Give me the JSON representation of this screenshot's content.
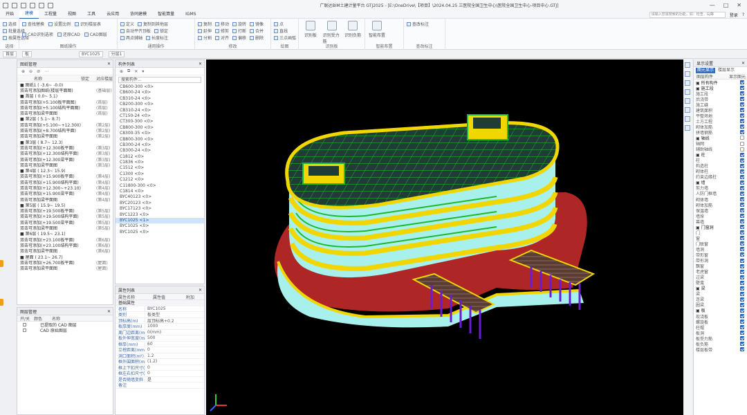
{
  "window": {
    "title": "广联达BIM土建计量平台 GTJ2025 - [E:\\OneDrive\\【项目】\\2024.04.25 三医院全国卫生中心\\医院全国卫生中心-项目中心.GTJ]",
    "controls": [
      "—",
      "□",
      "✕"
    ]
  },
  "menu": {
    "tabs": [
      "开始",
      "建模",
      "工程量",
      "视图",
      "工具",
      "云应用",
      "协同建模",
      "智能算量",
      "IGMS"
    ],
    "active": 1,
    "search_placeholder": "请输入您需搜索的功能，如：检查、GJ等",
    "user": "登录",
    "help": "?"
  },
  "ribbon": {
    "groups": [
      {
        "label": "选择",
        "items": [
          "选择",
          "批量选择",
          "按属性选择"
        ]
      },
      {
        "label": "图纸操作",
        "items": [
          "查找替换",
          "设置比例",
          "识别楼层表",
          "CAD识别选项",
          "还原CAD",
          "CAD图层"
        ]
      },
      {
        "label": "通用操作",
        "items": [
          "定义",
          "复制到其他层",
          "自动平齐顶板",
          "锁定",
          "两点辅轴",
          "长度标注"
        ]
      },
      {
        "label": "修改",
        "items": [
          "复制",
          "移动",
          "旋转",
          "镜像",
          "延伸",
          "修剪",
          "打断",
          "合并",
          "分割",
          "对齐",
          "偏移",
          "删除"
        ]
      },
      {
        "label": "绘图",
        "items": [
          "点",
          "直线",
          "三点画弧"
        ]
      },
      {
        "label": "识别板",
        "items": [
          "识别板",
          "识别受力筋",
          "识别负筋"
        ]
      },
      {
        "label": "智能布置",
        "items": [
          "智能布置"
        ]
      },
      {
        "label": "查改标注",
        "items": [
          "查改标注"
        ]
      }
    ]
  },
  "panebar": {
    "floor": "首层",
    "type": "板",
    "component": "BYC1025",
    "layer": "分层1"
  },
  "nav_panel": {
    "title": "图纸管理",
    "cols": [
      "名称",
      "锁定",
      "对应楼层"
    ],
    "rows": [
      {
        "n": "■ 图纸1 ( -3.6~ -0.0)",
        "c": "",
        "v": ""
      },
      {
        "n": "  双击可添加图纸(楼层平面图)",
        "c": "",
        "v": "(基础层)"
      },
      {
        "n": "■ 首层 ( 0.0~ 5.1)",
        "c": "",
        "v": ""
      },
      {
        "n": "  双击可添加(+5.100板平面图)",
        "c": "",
        "v": "(首层)"
      },
      {
        "n": "  双击可添加(+5.100结构平面图)",
        "c": "",
        "v": "(首层)"
      },
      {
        "n": "  双击可添加梁平面图",
        "c": "",
        "v": "(首层)"
      },
      {
        "n": "■ 第2层 ( 5.1~ 8.7)",
        "c": "",
        "v": ""
      },
      {
        "n": "  双击可添加(+5.100~+12.300)",
        "c": "",
        "v": "(第2层)"
      },
      {
        "n": "  双击可添加(+8.700结构平面)",
        "c": "",
        "v": "(第2层)"
      },
      {
        "n": "  双击可添加梁平面图",
        "c": "",
        "v": "(第2层)"
      },
      {
        "n": "■ 第3层 ( 8.7~ 12.3)",
        "c": "",
        "v": ""
      },
      {
        "n": "  双击可添加(+12.300板平面)",
        "c": "",
        "v": "(第3层)"
      },
      {
        "n": "  双击可添加(+12.300结构平面)",
        "c": "",
        "v": "(第3层)"
      },
      {
        "n": "  双击可添加(+12.300梁平面)",
        "c": "",
        "v": "(第3层)"
      },
      {
        "n": "  双击可添加梁平面图",
        "c": "",
        "v": "(第3层)"
      },
      {
        "n": "■ 第4层 ( 12.3~ 15.9)",
        "c": "",
        "v": ""
      },
      {
        "n": "  双击可添加(+15.900板平面)",
        "c": "",
        "v": "(第4层)"
      },
      {
        "n": "  双击可添加(+15.900结构平面)",
        "c": "",
        "v": "(第4层)"
      },
      {
        "n": "  双击可添加(+12.300~+23.10)",
        "c": "",
        "v": "(第4层)"
      },
      {
        "n": "  双击可添加(+15.900梁平面)",
        "c": "",
        "v": "(第4层)"
      },
      {
        "n": "  双击可添加梁平面图",
        "c": "",
        "v": "(第4层)"
      },
      {
        "n": "■ 第5层 ( 15.9~ 19.5)",
        "c": "",
        "v": ""
      },
      {
        "n": "  双击可添加(+19.500板平面)",
        "c": "",
        "v": "(第5层)"
      },
      {
        "n": "  双击可添加(+19.500结构平面)",
        "c": "",
        "v": "(第5层)"
      },
      {
        "n": "  双击可添加(+19.500梁平面)",
        "c": "",
        "v": "(第5层)"
      },
      {
        "n": "  双击可添加梁平面图",
        "c": "",
        "v": "(第5层)"
      },
      {
        "n": "■ 第6层 ( 19.5~ 23.1)",
        "c": "",
        "v": ""
      },
      {
        "n": "  双击可添加(+23.100板平面)",
        "c": "",
        "v": "(第6层)"
      },
      {
        "n": "  双击可添加(+23.100结构平面)",
        "c": "",
        "v": "(第6层)"
      },
      {
        "n": "  双击可添加梁平面图",
        "c": "",
        "v": "(第6层)"
      },
      {
        "n": "■ 屋面 ( 23.1~ 26.7)",
        "c": "",
        "v": ""
      },
      {
        "n": "  双击可添加(+26.700板平面)",
        "c": "",
        "v": "(屋面)"
      },
      {
        "n": "  双击可添加梁平面图",
        "c": "",
        "v": "(屋面)"
      }
    ]
  },
  "layer_panel": {
    "title": "图层管理",
    "cols": [
      "开/关",
      "颜色",
      "名称"
    ],
    "rows": [
      "已提取的 CAD 图层",
      "CAD 原始图层"
    ]
  },
  "comp_panel": {
    "title": "构件列表",
    "search": "搜索构件...",
    "items": [
      "CB600-300 <0>",
      "CB600-24 <0>",
      "CB310-24 <0>",
      "CB200-300 <0>",
      "CB310-24 <0>",
      "CT150-24 <0>",
      "CT300-300 <0>",
      "CB800-300 <0>",
      "C8300-35 <0>",
      "CB800-300 <0>",
      "CB300-24 <0>",
      "CB300-24 <0>",
      "C1812 <0>",
      "C1836 <0>",
      "C1512 <0>",
      "C1300 <0>",
      "C1212 <0>",
      "C11800-300 <0>",
      "C1814 <0>",
      "BYC40123 <0>",
      "BYC20123 <0>",
      "BYC17123 <0>",
      "BYC1223 <0>",
      "BYC1025 <1>",
      "BYC1025 <0>",
      "BYC1025 <0>"
    ],
    "selected": 23
  },
  "prop_panel": {
    "title": "属性列表",
    "cols": [
      "属性名称",
      "属性值",
      "附加"
    ],
    "group": "基础属性",
    "rows": [
      {
        "k": "名称",
        "v": "BYC1025"
      },
      {
        "k": "类别",
        "v": "板类型"
      },
      {
        "k": "顶标高(m)",
        "v": "层顶标高+0.2"
      },
      {
        "k": "板厚度(mm)",
        "v": "1000"
      },
      {
        "k": "离门边距离(mm)",
        "v": "0(mm)"
      },
      {
        "k": "板外伸宽度(mm)",
        "v": "500"
      },
      {
        "k": "框厚(mm)",
        "v": "60"
      },
      {
        "k": "立樘距离(mm)",
        "v": "0"
      },
      {
        "k": "洞口面积(m²)",
        "v": "1.2"
      },
      {
        "k": "框外围面积(m²)",
        "v": "(1.2)"
      },
      {
        "k": "框上下扣尺寸(...)",
        "v": "0"
      },
      {
        "k": "框左右扣尺寸(...)",
        "v": "0"
      },
      {
        "k": "是否随墙变斜",
        "v": "是"
      },
      {
        "k": "备注",
        "v": ""
      }
    ]
  },
  "display_panel": {
    "title": "显示设置",
    "tabs": [
      "图元显示",
      "楼层显示"
    ],
    "cols": [
      "图层构件",
      "显示图元"
    ],
    "rows": [
      {
        "n": "▣ 所有构件",
        "g": true,
        "c": true
      },
      {
        "n": "▣ 施工段",
        "g": true,
        "c": true
      },
      {
        "n": "  施工段",
        "g": false,
        "c": true
      },
      {
        "n": "  后浇带",
        "g": false,
        "c": true
      },
      {
        "n": "  施工缝",
        "g": false,
        "c": true
      },
      {
        "n": "  建筑面积",
        "g": false,
        "c": true
      },
      {
        "n": "  平整场地",
        "g": false,
        "c": true
      },
      {
        "n": "  土方工程",
        "g": false,
        "c": true
      },
      {
        "n": "  砌体加筋",
        "g": false,
        "c": true
      },
      {
        "n": "  拼墙钢筋",
        "g": false,
        "c": true
      },
      {
        "n": "▣ 轴线",
        "g": true,
        "c": false
      },
      {
        "n": "  轴网",
        "g": false,
        "c": false
      },
      {
        "n": "  辅助轴线",
        "g": false,
        "c": false
      },
      {
        "n": "▣ 柱",
        "g": true,
        "c": true
      },
      {
        "n": "  柱",
        "g": false,
        "c": true
      },
      {
        "n": "  构造柱",
        "g": false,
        "c": true
      },
      {
        "n": "  砌体柱",
        "g": false,
        "c": true
      },
      {
        "n": "  约束边缘柱",
        "g": false,
        "c": true
      },
      {
        "n": "▣ 墙",
        "g": true,
        "c": true
      },
      {
        "n": "  剪力墙",
        "g": false,
        "c": true
      },
      {
        "n": "  人防门框墙",
        "g": false,
        "c": true
      },
      {
        "n": "  砌体墙",
        "g": false,
        "c": true
      },
      {
        "n": "  砌体加筋",
        "g": false,
        "c": true
      },
      {
        "n": "  保温墙",
        "g": false,
        "c": true
      },
      {
        "n": "  墙垛",
        "g": false,
        "c": true
      },
      {
        "n": "  幕墙",
        "g": false,
        "c": true
      },
      {
        "n": "▣ 门窗洞",
        "g": true,
        "c": true
      },
      {
        "n": "  门",
        "g": false,
        "c": true
      },
      {
        "n": "  窗",
        "g": false,
        "c": true
      },
      {
        "n": "  门联窗",
        "g": false,
        "c": true
      },
      {
        "n": "  墙洞",
        "g": false,
        "c": true
      },
      {
        "n": "  带形窗",
        "g": false,
        "c": true
      },
      {
        "n": "  带形洞",
        "g": false,
        "c": true
      },
      {
        "n": "  飘窗",
        "g": false,
        "c": true
      },
      {
        "n": "  老虎窗",
        "g": false,
        "c": true
      },
      {
        "n": "  过梁",
        "g": false,
        "c": true
      },
      {
        "n": "  壁龛",
        "g": false,
        "c": true
      },
      {
        "n": "▣ 梁",
        "g": true,
        "c": true
      },
      {
        "n": "  梁",
        "g": false,
        "c": true
      },
      {
        "n": "  连梁",
        "g": false,
        "c": true
      },
      {
        "n": "  圈梁",
        "g": false,
        "c": true
      },
      {
        "n": "▣ 板",
        "g": true,
        "c": true
      },
      {
        "n": "  现浇板",
        "g": false,
        "c": true
      },
      {
        "n": "  螺旋板",
        "g": false,
        "c": true
      },
      {
        "n": "  柱帽",
        "g": false,
        "c": true
      },
      {
        "n": "  板洞",
        "g": false,
        "c": true
      },
      {
        "n": "  板受力筋",
        "g": false,
        "c": true
      },
      {
        "n": "  板负筋",
        "g": false,
        "c": true
      },
      {
        "n": "  楼层板带",
        "g": false,
        "c": true
      }
    ]
  },
  "colors": {
    "accent": "#2f6fc8",
    "slab_yellow": "#f2d600",
    "facade_cyan": "#a8f0ec",
    "rebar_green": "#1fb82a",
    "column_purple": "#6a1bd6"
  }
}
